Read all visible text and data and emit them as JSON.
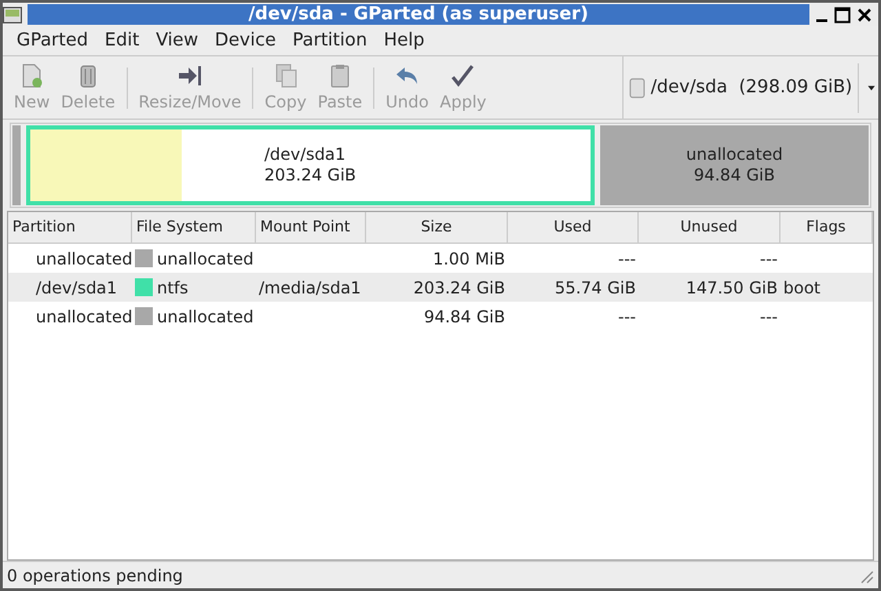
{
  "window": {
    "title": "/dev/sda - GParted (as superuser)"
  },
  "menu": [
    "GParted",
    "Edit",
    "View",
    "Device",
    "Partition",
    "Help"
  ],
  "toolbar": [
    {
      "label": "New",
      "kind": "new",
      "disabled": true
    },
    {
      "label": "Delete",
      "kind": "delete",
      "disabled": true
    },
    {
      "kind": "separator"
    },
    {
      "label": "Resize/Move",
      "kind": "resize",
      "disabled": true
    },
    {
      "kind": "separator"
    },
    {
      "label": "Copy",
      "kind": "copy",
      "disabled": true
    },
    {
      "label": "Paste",
      "kind": "paste",
      "disabled": true
    },
    {
      "kind": "separator"
    },
    {
      "label": "Undo",
      "kind": "undo",
      "disabled": true
    },
    {
      "label": "Apply",
      "kind": "apply",
      "disabled": true
    }
  ],
  "device_selector": {
    "value": "/dev/sda  (298.09 GiB)"
  },
  "disk_map": [
    {
      "kind": "unallocated"
    },
    {
      "kind": "partition",
      "name": "/dev/sda1",
      "size": "203.24 GiB",
      "color": "#40e0a8",
      "level": 0.27
    },
    {
      "kind": "unallocated",
      "name": "unallocated",
      "size": "94.84 GiB"
    }
  ],
  "table": {
    "columns": [
      "Partition",
      "File System",
      "Mount Point",
      "Size",
      "Used",
      "Unused",
      "Flags"
    ],
    "rows": [
      {
        "partition": "unallocated",
        "color": "#a8a8a8",
        "file_system": "unallocated",
        "size": "1.00 MiB",
        "used": "---",
        "unused": "---"
      },
      {
        "partition": "/dev/sda1",
        "color": "#40e0a8",
        "file_system": "ntfs",
        "mount_point": "/media/sda1",
        "size": "203.24 GiB",
        "used": "55.74 GiB",
        "unused": "147.50 GiB",
        "flags": "boot"
      },
      {
        "partition": "unallocated",
        "color": "#a8a8a8",
        "file_system": "unallocated",
        "size": "94.84 GiB",
        "used": "---",
        "unused": "---"
      }
    ]
  },
  "status_bar": "0 operations pending"
}
